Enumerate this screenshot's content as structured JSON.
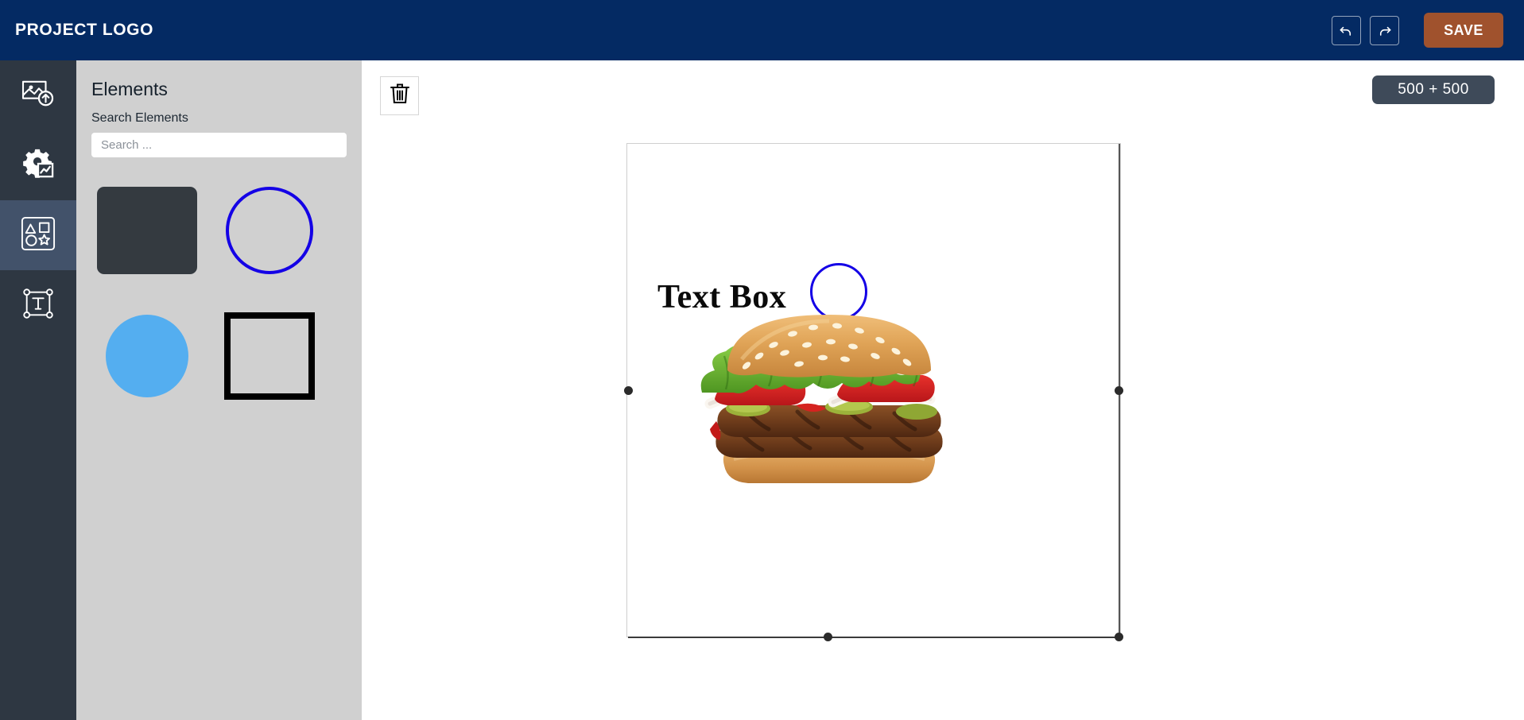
{
  "topbar": {
    "brand": "PROJECT LOGO",
    "undo_icon": "undo-arrow-icon",
    "redo_icon": "redo-arrow-icon",
    "save_label": "SAVE",
    "bg_color": "#042A63",
    "save_color": "#A0522D"
  },
  "rail": {
    "items": [
      {
        "icon": "image-upload-icon",
        "active": false
      },
      {
        "icon": "gear-chart-icon",
        "active": false
      },
      {
        "icon": "shapes-icon",
        "active": true
      },
      {
        "icon": "text-box-icon",
        "active": false
      }
    ],
    "bg_color": "#2E3742",
    "active_color": "#42526A"
  },
  "panel": {
    "title": "Elements",
    "search_label": "Search Elements",
    "search_value": "",
    "search_placeholder": "Search ...",
    "bg_color": "#D0D0D0",
    "shapes": [
      {
        "name": "rounded-rectangle-filled",
        "color": "#343A40"
      },
      {
        "name": "circle-outline",
        "color": "#1400E6"
      },
      {
        "name": "circle-filled",
        "color": "#54AEF0"
      },
      {
        "name": "square-outline",
        "color": "#000000"
      }
    ]
  },
  "workspace": {
    "trash_icon": "trash-icon",
    "size_badge": "500 + 500"
  },
  "canvas": {
    "objects": {
      "text_box": "Text Box",
      "circle": "circle-outline-object",
      "image": "burger-image-object"
    },
    "selected": true,
    "handles": [
      "left-middle",
      "right-middle",
      "bottom-center",
      "bottom-right-corner"
    ]
  }
}
